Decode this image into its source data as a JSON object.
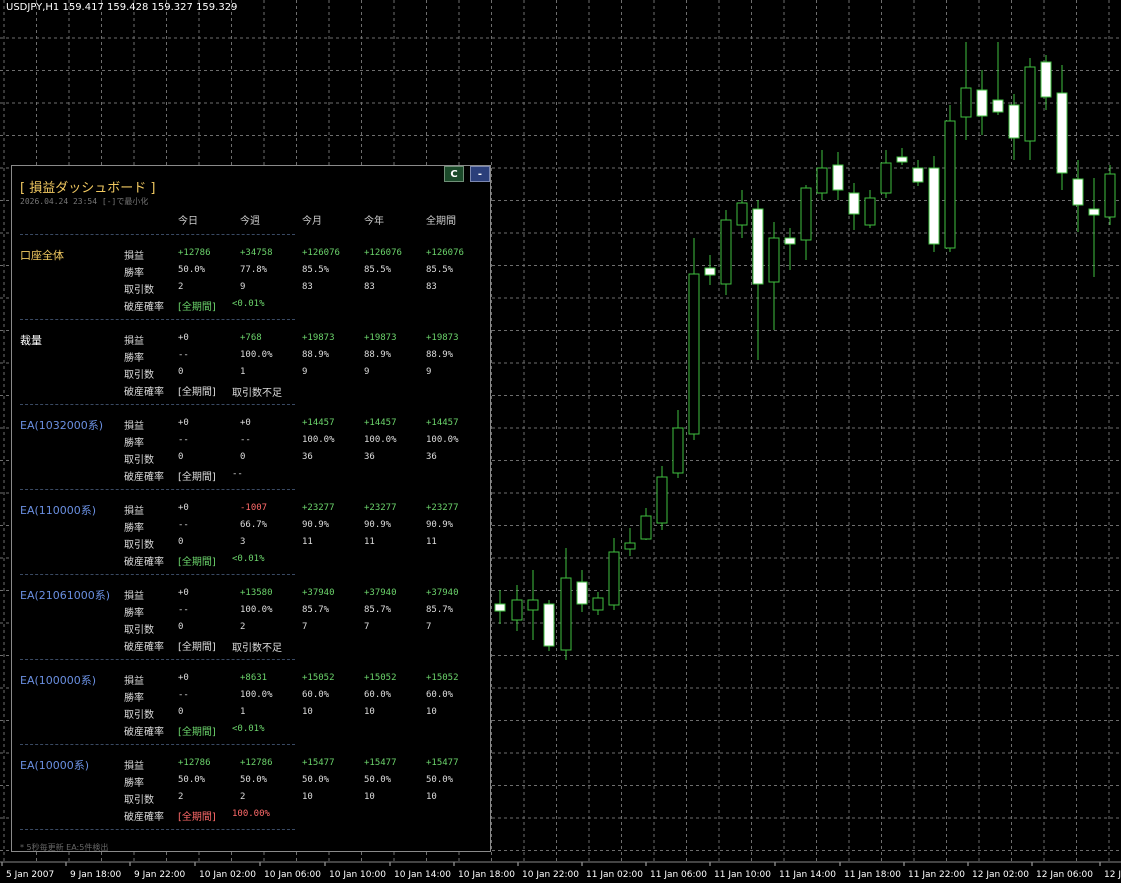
{
  "chart": {
    "symbol_line": "USDJPY,H1  159.417 159.428 159.327 159.329",
    "time_labels": [
      "5 Jan 2007",
      "9 Jan 18:00",
      "9 Jan 22:00",
      "10 Jan 02:00",
      "10 Jan 06:00",
      "10 Jan 10:00",
      "10 Jan 14:00",
      "10 Jan 18:00",
      "10 Jan 22:00",
      "11 Jan 02:00",
      "11 Jan 06:00",
      "11 Jan 10:00",
      "11 Jan 14:00",
      "11 Jan 18:00",
      "11 Jan 22:00",
      "12 Jan 02:00",
      "12 Jan 06:00",
      "12 Jan"
    ],
    "colors": {
      "grid": "#6e6e6e",
      "wick": "#3fbf3f",
      "bull_body": "#000000",
      "bear_body": "#ffffff"
    }
  },
  "panel": {
    "title": "[ 損益ダッシュボード ]",
    "subtitle": "2026.04.24 23:54  [-]で最小化",
    "btn_c": "C",
    "btn_min": "-",
    "columns": [
      "今日",
      "今週",
      "今月",
      "今年",
      "全期間"
    ],
    "row_labels": {
      "pnl": "損益",
      "win": "勝率",
      "trades": "取引数",
      "ruin": "破産確率"
    },
    "groups": [
      {
        "name": "口座全体",
        "name_color": "#f0c860",
        "pnl": [
          "+12786",
          "+34758",
          "+126076",
          "+126076",
          "+126076"
        ],
        "pnl_cls": [
          "pos",
          "pos",
          "pos",
          "pos",
          "pos"
        ],
        "win": [
          "50.0%",
          "77.8%",
          "85.5%",
          "85.5%",
          "85.5%"
        ],
        "trades": [
          "2",
          "9",
          "83",
          "83",
          "83"
        ],
        "ruin_tag": "[全期間]",
        "ruin_val": "<0.01%",
        "ruin_cls": "safe"
      },
      {
        "name": "裁量",
        "name_color": "#ffffff",
        "pnl": [
          "+0",
          "+768",
          "+19873",
          "+19873",
          "+19873"
        ],
        "pnl_cls": [
          "zero",
          "pos",
          "pos",
          "pos",
          "pos"
        ],
        "win": [
          "--",
          "100.0%",
          "88.9%",
          "88.9%",
          "88.9%"
        ],
        "trades": [
          "0",
          "1",
          "9",
          "9",
          "9"
        ],
        "ruin_tag": "[全期間]",
        "ruin_val": "取引数不足",
        "ruin_cls": "plain"
      },
      {
        "name": "EA(1032000系)",
        "name_color": "#6a8fe0",
        "pnl": [
          "+0",
          "+0",
          "+14457",
          "+14457",
          "+14457"
        ],
        "pnl_cls": [
          "zero",
          "zero",
          "pos",
          "pos",
          "pos"
        ],
        "win": [
          "--",
          "--",
          "100.0%",
          "100.0%",
          "100.0%"
        ],
        "trades": [
          "0",
          "0",
          "36",
          "36",
          "36"
        ],
        "ruin_tag": "[全期間]",
        "ruin_val": "--",
        "ruin_cls": "plain"
      },
      {
        "name": "EA(110000系)",
        "name_color": "#6a8fe0",
        "pnl": [
          "+0",
          "-1007",
          "+23277",
          "+23277",
          "+23277"
        ],
        "pnl_cls": [
          "zero",
          "neg",
          "pos",
          "pos",
          "pos"
        ],
        "win": [
          "--",
          "66.7%",
          "90.9%",
          "90.9%",
          "90.9%"
        ],
        "trades": [
          "0",
          "3",
          "11",
          "11",
          "11"
        ],
        "ruin_tag": "[全期間]",
        "ruin_val": "<0.01%",
        "ruin_cls": "safe"
      },
      {
        "name": "EA(21061000系)",
        "name_color": "#6a8fe0",
        "pnl": [
          "+0",
          "+13580",
          "+37940",
          "+37940",
          "+37940"
        ],
        "pnl_cls": [
          "zero",
          "pos",
          "pos",
          "pos",
          "pos"
        ],
        "win": [
          "--",
          "100.0%",
          "85.7%",
          "85.7%",
          "85.7%"
        ],
        "trades": [
          "0",
          "2",
          "7",
          "7",
          "7"
        ],
        "ruin_tag": "[全期間]",
        "ruin_val": "取引数不足",
        "ruin_cls": "plain"
      },
      {
        "name": "EA(100000系)",
        "name_color": "#6a8fe0",
        "pnl": [
          "+0",
          "+8631",
          "+15052",
          "+15052",
          "+15052"
        ],
        "pnl_cls": [
          "zero",
          "pos",
          "pos",
          "pos",
          "pos"
        ],
        "win": [
          "--",
          "100.0%",
          "60.0%",
          "60.0%",
          "60.0%"
        ],
        "trades": [
          "0",
          "1",
          "10",
          "10",
          "10"
        ],
        "ruin_tag": "[全期間]",
        "ruin_val": "<0.01%",
        "ruin_cls": "safe"
      },
      {
        "name": "EA(10000系)",
        "name_color": "#6a8fe0",
        "pnl": [
          "+12786",
          "+12786",
          "+15477",
          "+15477",
          "+15477"
        ],
        "pnl_cls": [
          "pos",
          "pos",
          "pos",
          "pos",
          "pos"
        ],
        "win": [
          "50.0%",
          "50.0%",
          "50.0%",
          "50.0%",
          "50.0%"
        ],
        "trades": [
          "2",
          "2",
          "10",
          "10",
          "10"
        ],
        "ruin_tag": "[全期間]",
        "ruin_val": "100.00%",
        "ruin_cls": "danger"
      }
    ],
    "footer": "* 5秒毎更新   EA:5件検出"
  }
}
